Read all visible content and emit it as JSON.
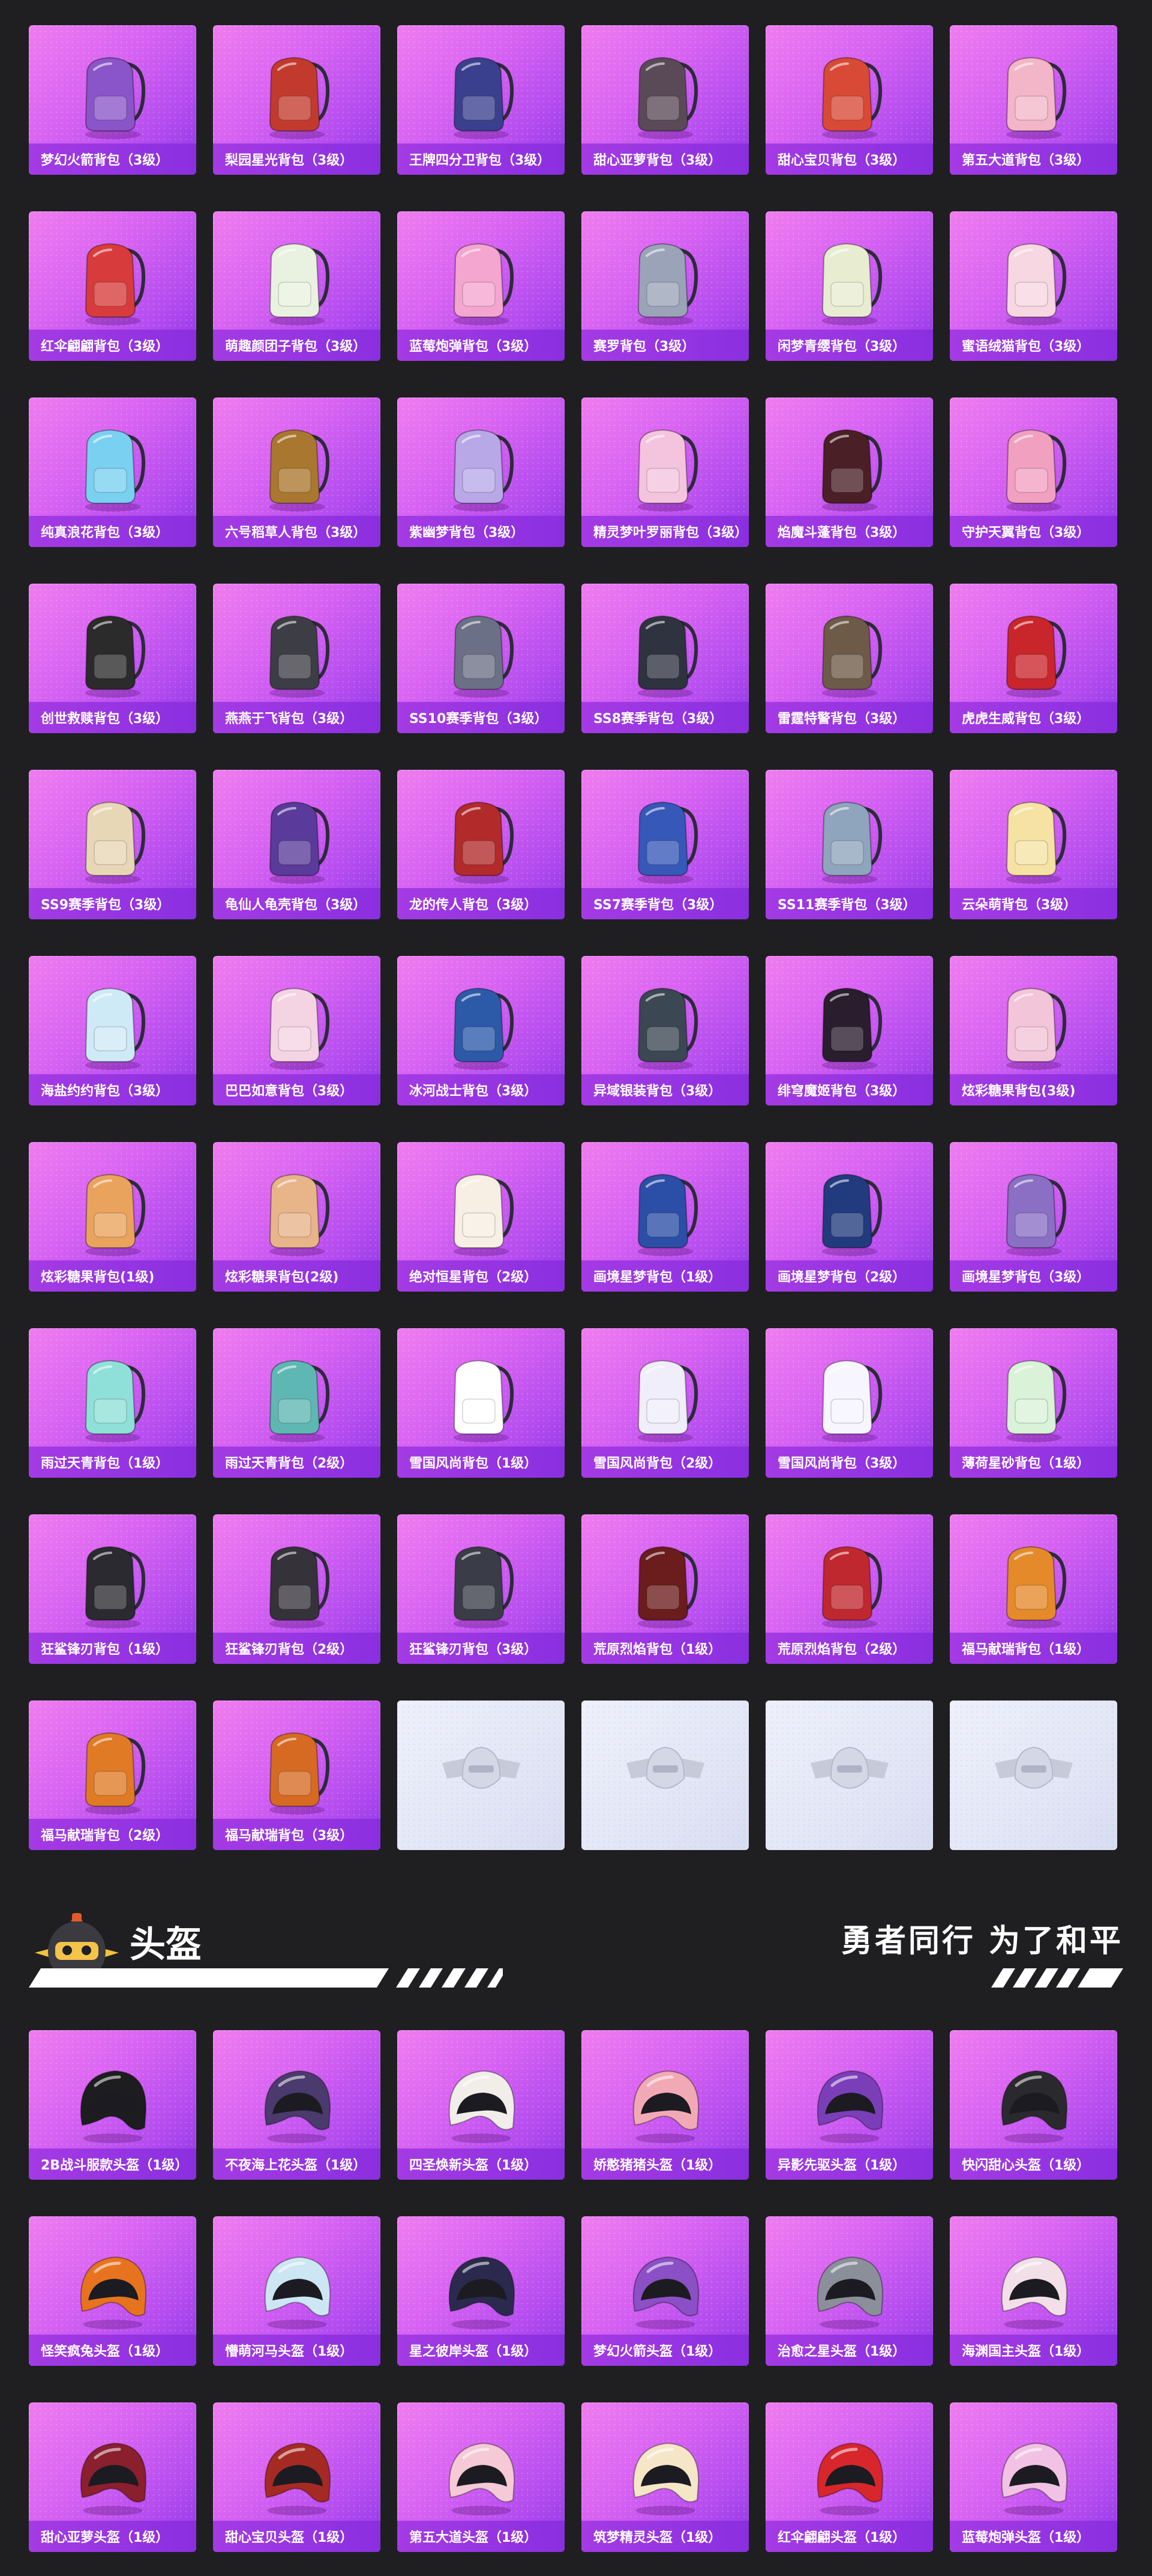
{
  "colors": {
    "page_bg": "#1f1f22",
    "card_gradient_start": "#f07cf0",
    "card_gradient_end": "#8f36e6",
    "label_bg": "#9a35e2",
    "locked_card_bg": "#e6e9f7",
    "text": "#ffffff"
  },
  "backpacks": [
    {
      "name": "梦幻火箭背包（3级）",
      "icon": "rocket-backpack-icon",
      "color": "#8a55c8"
    },
    {
      "name": "梨园星光背包（3级）",
      "icon": "opera-backpack-icon",
      "color": "#c23a2e"
    },
    {
      "name": "王牌四分卫背包（3级）",
      "icon": "shield-backpack-icon",
      "color": "#3a3f8e"
    },
    {
      "name": "甜心亚萝背包（3级）",
      "icon": "plaid-backpack-icon",
      "color": "#5a4a58"
    },
    {
      "name": "甜心宝贝背包（3级）",
      "icon": "cake-backpack-icon",
      "color": "#d84a36"
    },
    {
      "name": "第五大道背包（3级）",
      "icon": "quilted-backpack-icon",
      "color": "#f3b6c8"
    },
    {
      "name": "红伞翩翩背包（3级）",
      "icon": "mushroom-backpack-icon",
      "color": "#d83b3b"
    },
    {
      "name": "萌趣颜团子背包（3级）",
      "icon": "dumpling-backpack-icon",
      "color": "#e9f2e0"
    },
    {
      "name": "蓝莓炮弹背包（3级）",
      "icon": "icecream-backpack-icon",
      "color": "#f4a6d0"
    },
    {
      "name": "赛罗背包（3级）",
      "icon": "mecha-backpack-icon",
      "color": "#9aa3b8"
    },
    {
      "name": "闲梦青缨背包（3级）",
      "icon": "lantern-backpack-icon",
      "color": "#e8edd2"
    },
    {
      "name": "蜜语绒猫背包（3级）",
      "icon": "cat-backpack-icon",
      "color": "#f7d7e2"
    },
    {
      "name": "纯真浪花背包（3级）",
      "icon": "drink-backpack-icon",
      "color": "#7ad0f0"
    },
    {
      "name": "六号稻草人背包（3级）",
      "icon": "scarecrow-backpack-icon",
      "color": "#a9772f"
    },
    {
      "name": "紫幽梦背包（3级）",
      "icon": "bunny-backpack-icon",
      "color": "#b9a8e8"
    },
    {
      "name": "精灵梦叶罗丽背包（3级）",
      "icon": "heart-backpack-icon",
      "color": "#f4c4de"
    },
    {
      "name": "焰魔斗蓬背包（3级）",
      "icon": "demon-backpack-icon",
      "color": "#4a1f26"
    },
    {
      "name": "守护天翼背包（3级）",
      "icon": "wing-backpack-icon",
      "color": "#f2a0c0"
    },
    {
      "name": "创世救赎背包（3级）",
      "icon": "armor-backpack-icon",
      "color": "#2b2b2b"
    },
    {
      "name": "燕燕于飞背包（3级）",
      "icon": "swallow-backpack-icon",
      "color": "#3d3d45"
    },
    {
      "name": "SS10赛季背包（3级）",
      "icon": "season-backpack-icon",
      "color": "#6b7086"
    },
    {
      "name": "SS8赛季背包（3级）",
      "icon": "season-backpack-icon",
      "color": "#2f3340"
    },
    {
      "name": "雷霆特警背包（3级）",
      "icon": "tactical-backpack-icon",
      "color": "#6e5a48"
    },
    {
      "name": "虎虎生威背包（3级）",
      "icon": "tiger-backpack-icon",
      "color": "#c9262c"
    },
    {
      "name": "SS9赛季背包（3级）",
      "icon": "season-backpack-icon",
      "color": "#e8d7b6"
    },
    {
      "name": "龟仙人龟壳背包（3级）",
      "icon": "turtle-shell-backpack-icon",
      "color": "#5a3a9a"
    },
    {
      "name": "龙的传人背包（3级）",
      "icon": "dragon-backpack-icon",
      "color": "#b22a2a"
    },
    {
      "name": "SS7赛季背包（3级）",
      "icon": "season-backpack-icon",
      "color": "#3658b8"
    },
    {
      "name": "SS11赛季背包（3级）",
      "icon": "season-backpack-icon",
      "color": "#8fa4bd"
    },
    {
      "name": "云朵萌背包（3级）",
      "icon": "cloud-backpack-icon",
      "color": "#f6e3a4"
    },
    {
      "name": "海盐约约背包（3级）",
      "icon": "fish-backpack-icon",
      "color": "#cfeaf7"
    },
    {
      "name": "巴巴如意背包（3级）",
      "icon": "barbapapa-backpack-icon",
      "color": "#f4d4e3"
    },
    {
      "name": "冰河战士背包（3级）",
      "icon": "warrior-backpack-icon",
      "color": "#2c5aa8"
    },
    {
      "name": "异域银装背包（3级）",
      "icon": "tech-backpack-icon",
      "color": "#3b4752"
    },
    {
      "name": "绯穹魔姬背包（3级）",
      "icon": "bat-backpack-icon",
      "color": "#2a1d2e"
    },
    {
      "name": "炫彩糖果背包(3级)",
      "icon": "donut-backpack-icon",
      "color": "#f3c5d8"
    },
    {
      "name": "炫彩糖果背包(1级)",
      "icon": "donut-backpack-icon",
      "color": "#e9a35d"
    },
    {
      "name": "炫彩糖果背包(2级)",
      "icon": "donut-backpack-icon",
      "color": "#e8b489"
    },
    {
      "name": "绝对恒星背包（2级）",
      "icon": "noodle-box-backpack-icon",
      "color": "#f7efe3"
    },
    {
      "name": "画境星梦背包（1级）",
      "icon": "book-backpack-icon",
      "color": "#2b4ea6"
    },
    {
      "name": "画境星梦背包（2级）",
      "icon": "book-backpack-icon",
      "color": "#223b7e"
    },
    {
      "name": "画境星梦背包（3级）",
      "icon": "book-backpack-icon",
      "color": "#8a6fc4"
    },
    {
      "name": "雨过天青背包（1级）",
      "icon": "droplet-backpack-icon",
      "color": "#8fe0d8"
    },
    {
      "name": "雨过天青背包（2级）",
      "icon": "droplet-backpack-icon",
      "color": "#5fb7b3"
    },
    {
      "name": "雪国风尚背包（1级）",
      "icon": "snowman-backpack-icon",
      "color": "#ffffff"
    },
    {
      "name": "雪国风尚背包（2级）",
      "icon": "snowman-backpack-icon",
      "color": "#f0eefa"
    },
    {
      "name": "雪国风尚背包（3级）",
      "icon": "snowman-backpack-icon",
      "color": "#f7f5ff"
    },
    {
      "name": "薄荷星砂背包（1级）",
      "icon": "bottle-backpack-icon",
      "color": "#d9f2d8"
    },
    {
      "name": "狂鲨锋刃背包（1级）",
      "icon": "shark-backpack-icon",
      "color": "#2a2a30"
    },
    {
      "name": "狂鲨锋刃背包（2级）",
      "icon": "shark-backpack-icon",
      "color": "#35323a"
    },
    {
      "name": "狂鲨锋刃背包（3级）",
      "icon": "shark-backpack-icon",
      "color": "#3a3d48"
    },
    {
      "name": "荒原烈焰背包（1级）",
      "icon": "flame-backpack-icon",
      "color": "#6b1c1c"
    },
    {
      "name": "荒原烈焰背包（2级）",
      "icon": "flame-backpack-icon",
      "color": "#c0282f"
    },
    {
      "name": "福马献瑞背包（1级）",
      "icon": "horse-backpack-icon",
      "color": "#e58a2a"
    },
    {
      "name": "福马献瑞背包（2级）",
      "icon": "horse-backpack-icon",
      "color": "#e07a25"
    },
    {
      "name": "福马献瑞背包（3级）",
      "icon": "horse-backpack-icon",
      "color": "#d66a22"
    },
    {
      "name": "",
      "icon": "pubg-emblem-icon",
      "locked": true
    },
    {
      "name": "",
      "icon": "pubg-emblem-icon",
      "locked": true
    },
    {
      "name": "",
      "icon": "pubg-emblem-icon",
      "locked": true
    },
    {
      "name": "",
      "icon": "pubg-emblem-icon",
      "locked": true
    }
  ],
  "helmet_section": {
    "title": "头盔",
    "slogan": "勇者同行 为了和平",
    "mascot_icon": "knight-helmet-mascot-icon"
  },
  "helmets": [
    {
      "name": "2B战斗服款头盔（1级）",
      "icon": "helmet-icon",
      "color": "#1d1d20"
    },
    {
      "name": "不夜海上花头盔（1级）",
      "icon": "helmet-icon",
      "color": "#4a3a6e"
    },
    {
      "name": "四圣焕新头盔（1级）",
      "icon": "helmet-icon",
      "color": "#f1eeea"
    },
    {
      "name": "娇憨猪猪头盔（1级）",
      "icon": "pig-helmet-icon",
      "color": "#f2a9b6"
    },
    {
      "name": "异影先驱头盔（1级）",
      "icon": "helmet-icon",
      "color": "#7a3fb8"
    },
    {
      "name": "快闪甜心头盔（1级）",
      "icon": "helmet-icon",
      "color": "#2a2a2e"
    },
    {
      "name": "怪笑疯兔头盔（1级）",
      "icon": "helmet-icon",
      "color": "#e8731f"
    },
    {
      "name": "懵萌河马头盔（1级）",
      "icon": "helmet-icon",
      "color": "#cde6f4"
    },
    {
      "name": "星之彼岸头盔（1级）",
      "icon": "helmet-icon",
      "color": "#2b2a4e"
    },
    {
      "name": "梦幻火箭头盔（1级）",
      "icon": "helmet-icon",
      "color": "#8b4fc6"
    },
    {
      "name": "治愈之星头盔（1级）",
      "icon": "helmet-icon",
      "color": "#8a8f9a"
    },
    {
      "name": "海渊国主头盔（1级）",
      "icon": "helmet-icon",
      "color": "#f2dfe8"
    },
    {
      "name": "甜心亚萝头盔（1级）",
      "icon": "helmet-icon",
      "color": "#8a1f2e"
    },
    {
      "name": "甜心宝贝头盔（1级）",
      "icon": "helmet-icon",
      "color": "#a52a23"
    },
    {
      "name": "第五大道头盔（1级）",
      "icon": "helmet-icon",
      "color": "#f5c9d6"
    },
    {
      "name": "筑梦精灵头盔（1级）",
      "icon": "helmet-icon",
      "color": "#f5e6c8"
    },
    {
      "name": "红伞翩翩头盔（1级）",
      "icon": "helmet-icon",
      "color": "#d7262c"
    },
    {
      "name": "蓝莓炮弹头盔（1级）",
      "icon": "helmet-icon",
      "color": "#f2c2e4"
    }
  ]
}
